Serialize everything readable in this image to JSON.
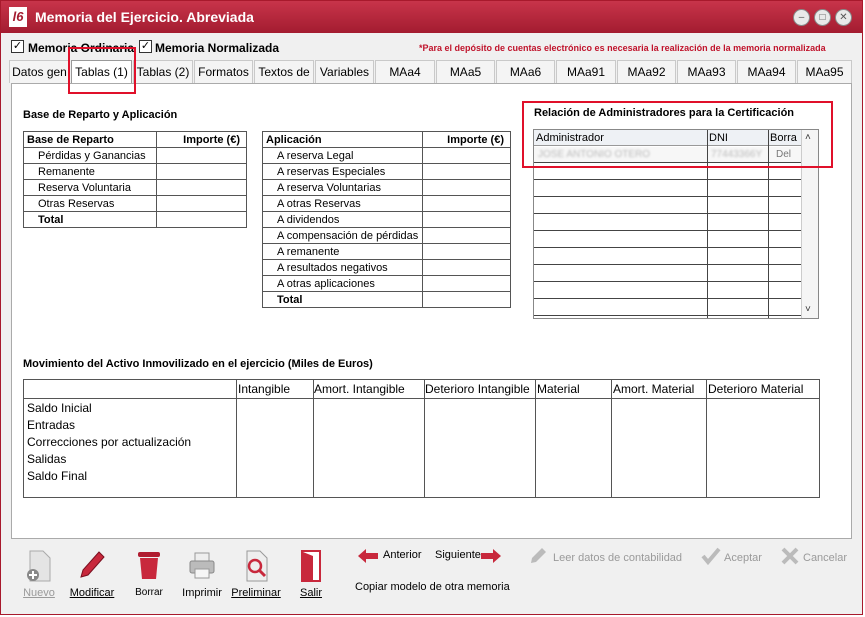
{
  "window": {
    "title": "Memoria del Ejercicio. Abreviada",
    "logo": "l6",
    "colors": {
      "title_bar": "#b0263b",
      "notice": "#c0142c",
      "highlight": "#e0102a"
    }
  },
  "options": {
    "memoria_ordinaria": {
      "label": "Memoria Ordinaria",
      "checked": true
    },
    "memoria_normalizada": {
      "label": "Memoria Normalizada",
      "checked": true
    },
    "notice": "*Para el depósito de cuentas electrónico es necesaria la realización de la memoria normalizada"
  },
  "tabs": [
    "Datos gen",
    "Tablas (1)",
    "Tablas (2)",
    "Formatos",
    "Textos de",
    "Variables",
    "MAa4",
    "MAa5",
    "MAa6",
    "MAa91",
    "MAa92",
    "MAa93",
    "MAa94",
    "MAa95"
  ],
  "active_tab": "Tablas (1)",
  "reparto": {
    "section_title": "Base de Reparto y Aplicación",
    "base": {
      "header": "Base de Reparto",
      "amount_header": "Importe (€)",
      "rows": [
        "Pérdidas y Ganancias",
        "Remanente",
        "Reserva Voluntaria",
        "Otras Reservas"
      ],
      "total": "Total"
    },
    "aplicacion": {
      "header": "Aplicación",
      "amount_header": "Importe (€)",
      "rows": [
        "A reserva Legal",
        "A reservas Especiales",
        "A reserva Voluntarias",
        "A otras Reservas",
        "A dividendos",
        "A compensación de pérdidas",
        "A remanente",
        "A resultados negativos",
        "A otras aplicaciones"
      ],
      "total": "Total"
    }
  },
  "administradores": {
    "title": "Relación de Administradores para la Certificación",
    "columns": [
      "Administrador",
      "DNI",
      "Borra"
    ],
    "first_row": {
      "name": "JOSE ANTONIO OTERO",
      "dni": "77443366Y",
      "action": "Del"
    }
  },
  "movimiento": {
    "title": "Movimiento del Activo Inmovilizado en el ejercicio (Miles de Euros)",
    "columns": [
      "Intangible",
      "Amort. Intangible",
      "Deterioro Intangible",
      "Material",
      "Amort. Material",
      "Deterioro Material"
    ],
    "rows": [
      "Saldo Inicial",
      "Entradas",
      "Correcciones por actualización",
      "Salidas",
      "Saldo Final"
    ]
  },
  "toolbar": {
    "nuevo": "Nuevo",
    "modificar": "Modificar",
    "borrar": "Borrar",
    "imprimir": "Imprimir",
    "preliminar": "Preliminar",
    "salir": "Salir",
    "anterior": "Anterior",
    "siguiente": "Siguiente",
    "copiar": "Copiar modelo de otra memoria",
    "leer": "Leer datos de contabilidad",
    "aceptar": "Aceptar",
    "cancelar": "Cancelar"
  }
}
